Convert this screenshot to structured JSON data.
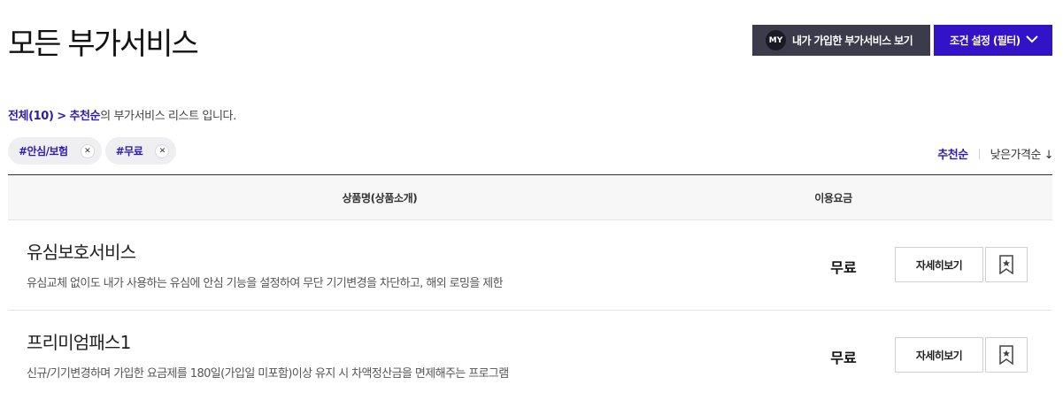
{
  "header": {
    "title": "모든 부가서비스",
    "my_badge": "MY",
    "my_button_label": "내가 가입한 부가서비스 보기",
    "filter_button_label": "조건 설정 (필터)"
  },
  "summary": {
    "total": "전체(10)",
    "separator": ">",
    "sort_name": "추천순",
    "suffix": "의 부가서비스 리스트 입니다."
  },
  "tags": [
    {
      "label": "#안심/보험"
    },
    {
      "label": "#무료"
    }
  ],
  "sort": {
    "active": "추천순",
    "other": "낮은가격순 ↓"
  },
  "table": {
    "col_name": "상품명(상품소개)",
    "col_fee": "이용요금",
    "rows": [
      {
        "title": "유심보호서비스",
        "desc": "유심교체 없이도 내가 사용하는 유심에 안심 기능을 설정하여 무단 기기변경을 차단하고, 해외 로밍을 제한",
        "fee": "무료",
        "detail_label": "자세히보기"
      },
      {
        "title": "프리미엄패스1",
        "desc": "신규/기기변경하며 가입한 요금제를 180일(가입일 미포함)이상 유지 시 차액정산금을 면제해주는 프로그램",
        "fee": "무료",
        "detail_label": "자세히보기"
      }
    ]
  },
  "colors": {
    "accent": "#3213c8",
    "dark_button": "#3c3b4c",
    "link": "#2e1ab8"
  },
  "icons": {
    "filter_toggle": "chevron-down-icon",
    "tag_remove": "close-icon",
    "bookmark": "bookmark-star-icon"
  }
}
